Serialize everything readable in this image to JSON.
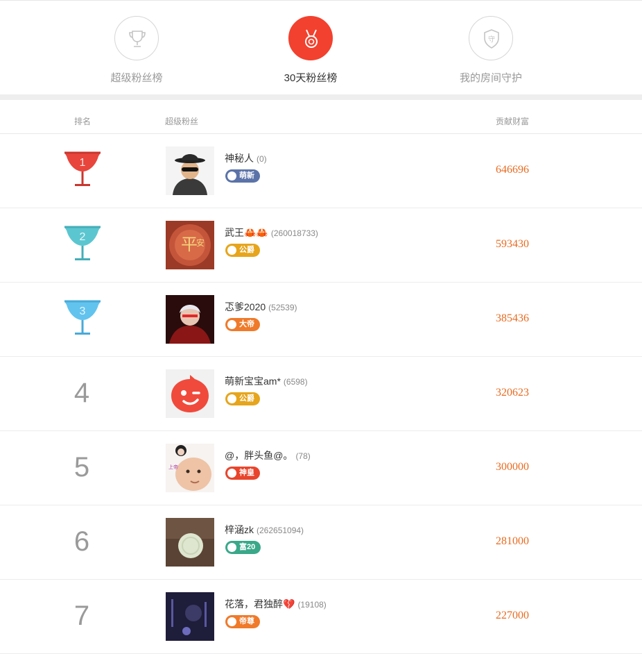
{
  "tabs": [
    {
      "label": "超级粉丝榜",
      "icon": "trophy-icon",
      "active": false
    },
    {
      "label": "30天粉丝榜",
      "icon": "medal-icon",
      "active": true
    },
    {
      "label": "我的房间守护",
      "icon": "shield-guard-icon",
      "active": false
    }
  ],
  "tab_shield_text": "守",
  "header": {
    "rank": "排名",
    "fans": "超级粉丝",
    "wealth": "贡献财富"
  },
  "colors": {
    "accent": "#f2412e",
    "wealth": "#e86a1f",
    "rank1": "#e8453c",
    "rank2": "#5cc6d0",
    "rank3": "#62c3ee"
  },
  "rows": [
    {
      "rank": "1",
      "name": "神秘人",
      "emoji": "",
      "uid": "(0)",
      "badge": "萌新",
      "badge_color": "#5b73a8",
      "wealth": "646696",
      "avatar": "mystery-person-avatar"
    },
    {
      "rank": "2",
      "name": "武王",
      "emoji": "🦀🦀",
      "uid": "(260018733)",
      "badge": "公爵",
      "badge_color": "#e6a51c",
      "wealth": "593430",
      "avatar": "pingan-avatar"
    },
    {
      "rank": "3",
      "name": "忑爹2020",
      "emoji": "",
      "uid": "(52539)",
      "badge": "大帝",
      "badge_color": "#ef7a2a",
      "wealth": "385436",
      "avatar": "red-hero-avatar"
    },
    {
      "rank": "4",
      "name": "萌新宝宝am*",
      "emoji": "",
      "uid": "(6598)",
      "badge": "公爵",
      "badge_color": "#e6a51c",
      "wealth": "320623",
      "avatar": "wink-logo-avatar"
    },
    {
      "rank": "5",
      "name": "@，胖头鱼@。",
      "emoji": "",
      "uid": "(78)",
      "badge": "神皇",
      "badge_color": "#e8452c",
      "wealth": "300000",
      "avatar": "baby-avatar"
    },
    {
      "rank": "6",
      "name": "梓涵zk",
      "emoji": "",
      "uid": "(262651094)",
      "badge": "富20",
      "badge_color": "#3aa889",
      "wealth": "281000",
      "avatar": "jade-avatar"
    },
    {
      "rank": "7",
      "name": "花落，君独醉",
      "emoji": "💔",
      "uid": "(19108)",
      "badge": "帝尊",
      "badge_color": "#ef7a2a",
      "wealth": "227000",
      "avatar": "night-avatar"
    }
  ]
}
